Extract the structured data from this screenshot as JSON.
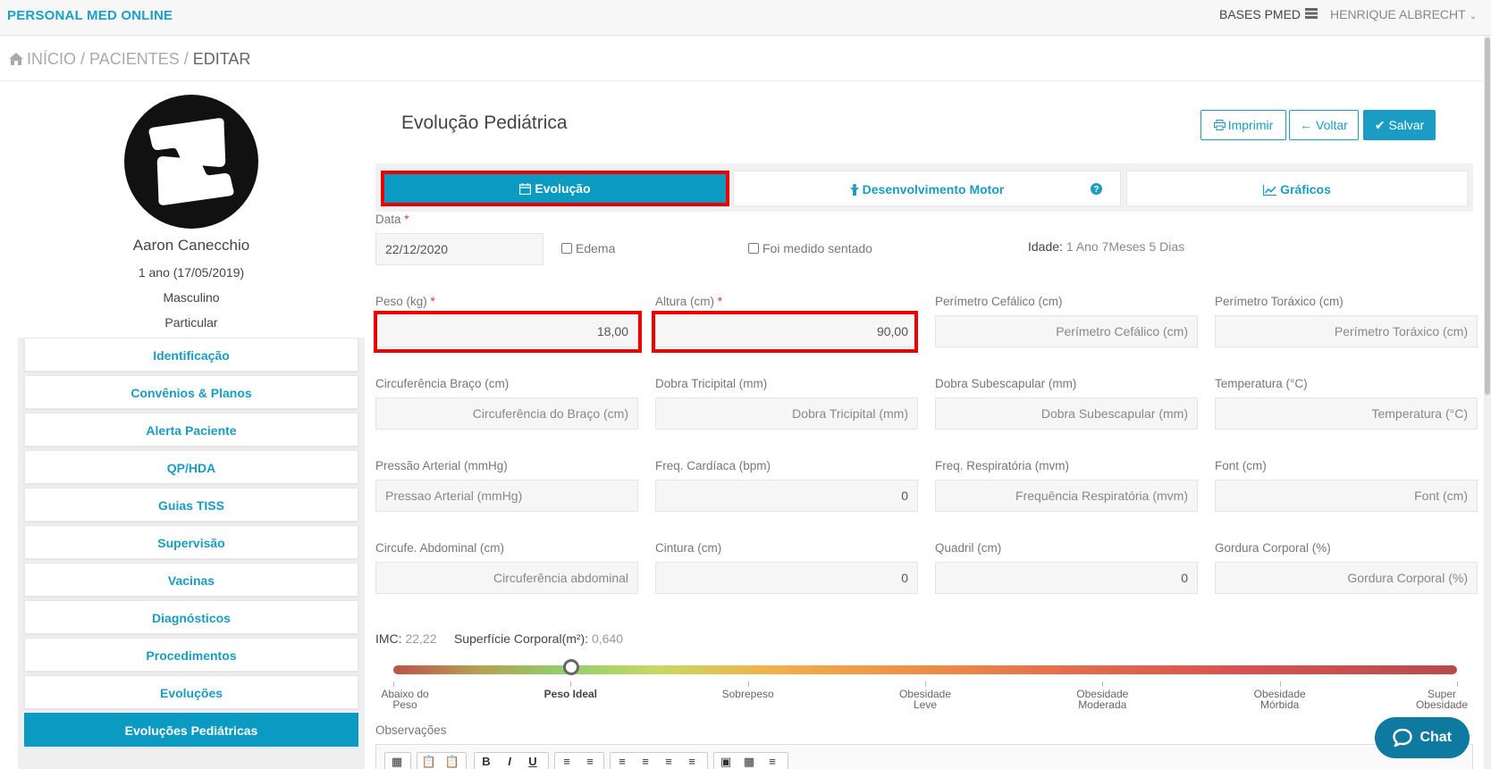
{
  "topbar": {
    "brand": "PERSONAL MED ONLINE",
    "bases": "BASES PMED",
    "user": "HENRIQUE ALBRECHT"
  },
  "breadcrumb": {
    "home": "INÍCIO",
    "patients": "PACIENTES",
    "current": "EDITAR",
    "sep": "/"
  },
  "patient": {
    "name": "Aaron Canecchio",
    "age": "1 ano (17/05/2019)",
    "sex": "Masculino",
    "plan": "Particular"
  },
  "sidebar": {
    "items": [
      {
        "label": "Identificação",
        "active": false
      },
      {
        "label": "Convênios & Planos",
        "active": false
      },
      {
        "label": "Alerta Paciente",
        "active": false
      },
      {
        "label": "QP/HDA",
        "active": false
      },
      {
        "label": "Guias TISS",
        "active": false
      },
      {
        "label": "Supervisão",
        "active": false
      },
      {
        "label": "Vacinas",
        "active": false
      },
      {
        "label": "Diagnósticos",
        "active": false
      },
      {
        "label": "Procedimentos",
        "active": false
      },
      {
        "label": "Evoluções",
        "active": false
      },
      {
        "label": "Evoluções Pediátricas",
        "active": true
      }
    ]
  },
  "page": {
    "title": "Evolução Pediátrica",
    "print_label": "Imprimir",
    "back_label": "Voltar",
    "save_label": "Salvar"
  },
  "tabs": [
    {
      "label": "Evolução",
      "icon": "calendar-icon",
      "active": true
    },
    {
      "label": "Desenvolvimento Motor",
      "icon": "child-icon",
      "active": false
    },
    {
      "label": "Gráficos",
      "icon": "line-chart-icon",
      "active": false
    }
  ],
  "form": {
    "date_label": "Data",
    "date_value": "22/12/2020",
    "edema_label": "Edema",
    "sitting_label": "Foi medido sentado",
    "age_label": "Idade:",
    "age_value": "1 Ano 7Meses 5 Dias",
    "fields": {
      "peso": {
        "label": "Peso (kg)",
        "value": "18,00"
      },
      "altura": {
        "label": "Altura (cm)",
        "value": "90,00"
      },
      "perim_cef": {
        "label": "Perímetro Cefálico (cm)",
        "placeholder": "Perímetro Cefálico (cm)"
      },
      "perim_tor": {
        "label": "Perímetro Toráxico (cm)",
        "placeholder": "Perímetro Toráxico (cm)"
      },
      "circ_braco": {
        "label": "Circuferência Braço (cm)",
        "placeholder": "Circuferência do Braço (cm)"
      },
      "dobra_tri": {
        "label": "Dobra Tricipital (mm)",
        "placeholder": "Dobra Tricipital (mm)"
      },
      "dobra_sub": {
        "label": "Dobra Subescapular (mm)",
        "placeholder": "Dobra Subescapular (mm)"
      },
      "temp": {
        "label": "Temperatura (°C)",
        "placeholder": "Temperatura (°C)"
      },
      "pressao": {
        "label": "Pressão Arterial (mmHg)",
        "placeholder": "Pressao Arterial (mmHg)"
      },
      "freq_card": {
        "label": "Freq. Cardíaca (bpm)",
        "value": "0"
      },
      "freq_resp": {
        "label": "Freq. Respiratória (mvm)",
        "placeholder": "Frequência Respiratória (mvm)"
      },
      "font": {
        "label": "Font (cm)",
        "placeholder": "Font (cm)"
      },
      "circ_abd": {
        "label": "Circufe. Abdominal (cm)",
        "placeholder": "Circuferência abdominal"
      },
      "cintura": {
        "label": "Cintura (cm)",
        "value": "0"
      },
      "quadril": {
        "label": "Quadril (cm)",
        "value": "0"
      },
      "gordura": {
        "label": "Gordura Corporal (%)",
        "placeholder": "Gordura Corporal (%)"
      }
    }
  },
  "imc": {
    "label": "IMC:",
    "value": "22,22",
    "surface_label": "Superfície Corporal(m²):",
    "surface_value": "0,640",
    "scale_position": 0.167,
    "scale_labels": [
      {
        "line1": "Abaixo do",
        "line2": "Peso"
      },
      {
        "line1": "Peso Ideal",
        "line2": ""
      },
      {
        "line1": "Sobrepeso",
        "line2": ""
      },
      {
        "line1": "Obesidade",
        "line2": "Leve"
      },
      {
        "line1": "Obesidade",
        "line2": "Moderada"
      },
      {
        "line1": "Obesidade",
        "line2": "Mórbida"
      },
      {
        "line1": "Super",
        "line2": "Obesidade"
      }
    ]
  },
  "observacoes": {
    "label": "Observações"
  },
  "chat": {
    "label": "Chat"
  },
  "colors": {
    "accent": "#1a9cc4",
    "active_tab": "#0b9bc2",
    "highlight": "#ee0000",
    "chat": "#0e7aa0"
  }
}
